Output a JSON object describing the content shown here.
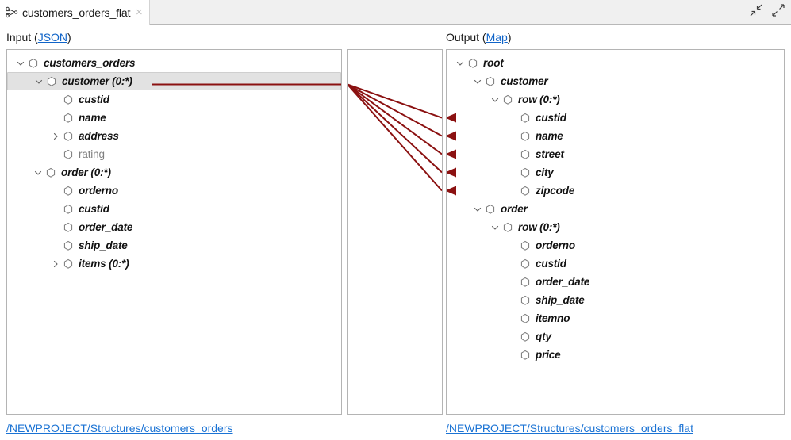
{
  "window": {
    "tab": {
      "title": "customers_orders_flat",
      "icon": "mapping-graph-icon",
      "close": "×"
    },
    "controls": {
      "collapse": "collapse-icon",
      "expand": "expand-icon"
    }
  },
  "input": {
    "caption_prefix": "Input (",
    "caption_link": "JSON",
    "caption_suffix": ")",
    "footer_link": "/NEWPROJECT/Structures/customers_orders",
    "nodes": [
      {
        "label": "customers_orders",
        "depth": 0,
        "twisty": "expanded",
        "style": "mapped",
        "selected": false
      },
      {
        "label": "customer (0:*)",
        "depth": 1,
        "twisty": "expanded",
        "style": "mapped",
        "selected": true
      },
      {
        "label": "custid",
        "depth": 2,
        "twisty": "none",
        "style": "mapped",
        "selected": false
      },
      {
        "label": "name",
        "depth": 2,
        "twisty": "none",
        "style": "mapped",
        "selected": false
      },
      {
        "label": "address",
        "depth": 2,
        "twisty": "collapsed",
        "style": "mapped",
        "selected": false
      },
      {
        "label": "rating",
        "depth": 2,
        "twisty": "none",
        "style": "unmapped",
        "selected": false
      },
      {
        "label": "order (0:*)",
        "depth": 1,
        "twisty": "expanded",
        "style": "mapped",
        "selected": false
      },
      {
        "label": "orderno",
        "depth": 2,
        "twisty": "none",
        "style": "mapped",
        "selected": false
      },
      {
        "label": "custid",
        "depth": 2,
        "twisty": "none",
        "style": "mapped",
        "selected": false
      },
      {
        "label": "order_date",
        "depth": 2,
        "twisty": "none",
        "style": "mapped",
        "selected": false
      },
      {
        "label": "ship_date",
        "depth": 2,
        "twisty": "none",
        "style": "mapped",
        "selected": false
      },
      {
        "label": "items (0:*)",
        "depth": 2,
        "twisty": "collapsed",
        "style": "mapped",
        "selected": false
      }
    ]
  },
  "output": {
    "caption_prefix": "Output (",
    "caption_link": "Map",
    "caption_suffix": ")",
    "footer_link": "/NEWPROJECT/Structures/customers_orders_flat",
    "nodes": [
      {
        "label": "root",
        "depth": 0,
        "twisty": "expanded",
        "style": "mapped",
        "arrow": false
      },
      {
        "label": "customer",
        "depth": 1,
        "twisty": "expanded",
        "style": "mapped",
        "arrow": false
      },
      {
        "label": "row (0:*)",
        "depth": 2,
        "twisty": "expanded",
        "style": "mapped",
        "arrow": false
      },
      {
        "label": "custid",
        "depth": 3,
        "twisty": "none",
        "style": "mapped",
        "arrow": true
      },
      {
        "label": "name",
        "depth": 3,
        "twisty": "none",
        "style": "mapped",
        "arrow": true
      },
      {
        "label": "street",
        "depth": 3,
        "twisty": "none",
        "style": "mapped",
        "arrow": true
      },
      {
        "label": "city",
        "depth": 3,
        "twisty": "none",
        "style": "mapped",
        "arrow": true
      },
      {
        "label": "zipcode",
        "depth": 3,
        "twisty": "none",
        "style": "mapped",
        "arrow": true
      },
      {
        "label": "order",
        "depth": 1,
        "twisty": "expanded",
        "style": "mapped",
        "arrow": false
      },
      {
        "label": "row (0:*)",
        "depth": 2,
        "twisty": "expanded",
        "style": "mapped",
        "arrow": false
      },
      {
        "label": "orderno",
        "depth": 3,
        "twisty": "none",
        "style": "mapped",
        "arrow": false
      },
      {
        "label": "custid",
        "depth": 3,
        "twisty": "none",
        "style": "mapped",
        "arrow": false
      },
      {
        "label": "order_date",
        "depth": 3,
        "twisty": "none",
        "style": "mapped",
        "arrow": false
      },
      {
        "label": "ship_date",
        "depth": 3,
        "twisty": "none",
        "style": "mapped",
        "arrow": false
      },
      {
        "label": "itemno",
        "depth": 3,
        "twisty": "none",
        "style": "mapped",
        "arrow": false
      },
      {
        "label": "qty",
        "depth": 3,
        "twisty": "none",
        "style": "mapped",
        "arrow": false
      },
      {
        "label": "price",
        "depth": 3,
        "twisty": "none",
        "style": "mapped",
        "arrow": false
      }
    ]
  },
  "mapping": {
    "line_color": "#8b1111",
    "source_node": "customer (0:*)",
    "targets": [
      "custid",
      "name",
      "street",
      "city",
      "zipcode"
    ]
  },
  "colors": {
    "link": "#1b73d4",
    "mapping_line": "#8b1111",
    "selection": "#e2e2e2",
    "panel_border": "#b4b4b4",
    "tabbar": "#f0f0f0"
  }
}
